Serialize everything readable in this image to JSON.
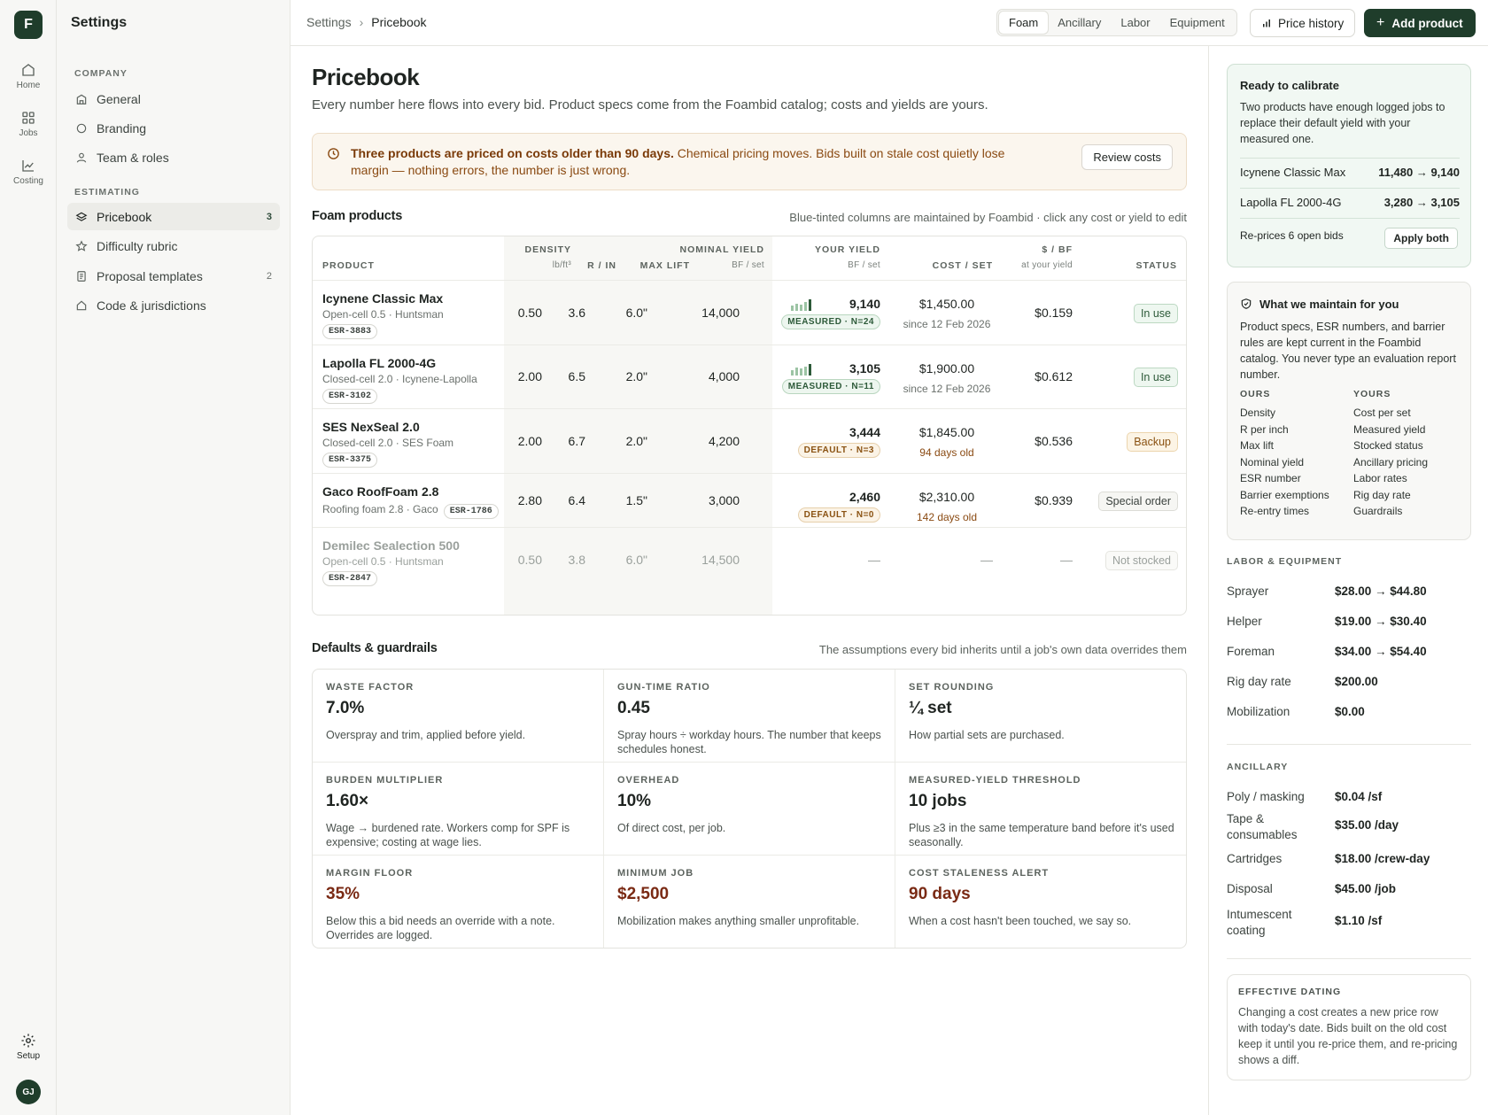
{
  "rail": {
    "logo": "F",
    "items": [
      {
        "label": "Home",
        "icon": "home-icon"
      },
      {
        "label": "Jobs",
        "icon": "grid-icon"
      },
      {
        "label": "Costing",
        "icon": "chart-line-icon"
      }
    ],
    "setup": "Setup",
    "avatar": "GJ"
  },
  "nav": {
    "title": "Settings",
    "sections": [
      {
        "heading": "COMPANY",
        "items": [
          {
            "label": "General",
            "count": ""
          },
          {
            "label": "Branding",
            "count": ""
          },
          {
            "label": "Team & roles",
            "count": ""
          }
        ]
      },
      {
        "heading": "ESTIMATING",
        "items": [
          {
            "label": "Pricebook",
            "count": "3"
          },
          {
            "label": "Difficulty rubric",
            "count": ""
          },
          {
            "label": "Proposal templates",
            "count": "2"
          },
          {
            "label": "Code & jurisdictions",
            "count": ""
          }
        ]
      }
    ]
  },
  "topbar": {
    "breadcrumb": [
      "Settings",
      "Pricebook"
    ],
    "tabs": [
      "Foam",
      "Ancillary",
      "Labor",
      "Equipment"
    ],
    "active_tab": "Foam",
    "price_history": "Price history",
    "add_product": "Add product"
  },
  "page": {
    "title": "Pricebook",
    "lede": "Every number here flows into every bid. Product specs come from the Foambid catalog; costs and yields are yours.",
    "alert_bold": "Three products are priced on costs older than 90 days.",
    "alert_text": " Chemical pricing moves. Bids built on stale cost quietly lose margin — nothing errors, the number is just wrong.",
    "review_costs": "Review costs"
  },
  "products": {
    "heading": "Foam products",
    "note": "Blue-tinted columns are maintained by Foambid · click any cost or yield to edit",
    "columns": {
      "product": "PRODUCT",
      "density": "DENSITY",
      "density_unit": "lb/ft³",
      "r_in": "R / IN",
      "max_lift": "MAX LIFT",
      "nominal": "NOMINAL YIELD",
      "nominal_unit": "BF / set",
      "your_yield": "YOUR YIELD",
      "your_yield_unit": "BF / set",
      "cost": "COST / SET",
      "per_bf": "$ / BF",
      "per_bf_unit": "at your yield",
      "status": "STATUS"
    },
    "rows": [
      {
        "name": "Icynene Classic Max",
        "meta": "Open-cell 0.5 · Huntsman",
        "esr": "ESR-3883",
        "density": "0.50",
        "r": "3.6",
        "lift": "6.0\"",
        "nominal": "14,000",
        "yield": "9,140",
        "yield_badge": "MEASURED · N=24",
        "yield_kind": "measured",
        "spark": [
          0.45,
          0.65,
          0.55,
          0.8,
          1
        ],
        "cost": "$1,450.00",
        "since": "since 12 Feb 2026",
        "since_kind": "ok",
        "per_bf": "$0.159",
        "status": "In use",
        "status_kind": "use"
      },
      {
        "name": "Lapolla FL 2000-4G",
        "meta": "Closed-cell 2.0 · Icynene-Lapolla",
        "esr": "ESR-3102",
        "density": "2.00",
        "r": "6.5",
        "lift": "2.0\"",
        "nominal": "4,000",
        "yield": "3,105",
        "yield_badge": "MEASURED · N=11",
        "yield_kind": "measured",
        "spark": [
          0.5,
          0.7,
          0.6,
          0.75,
          1
        ],
        "cost": "$1,900.00",
        "since": "since 12 Feb 2026",
        "since_kind": "ok",
        "per_bf": "$0.612",
        "status": "In use",
        "status_kind": "use"
      },
      {
        "name": "SES NexSeal 2.0",
        "meta": "Closed-cell 2.0 · SES Foam",
        "esr": "ESR-3375",
        "density": "2.00",
        "r": "6.7",
        "lift": "2.0\"",
        "nominal": "4,200",
        "yield": "3,444",
        "yield_badge": "DEFAULT · N=3",
        "yield_kind": "default",
        "spark": [],
        "cost": "$1,845.00",
        "since": "94 days old",
        "since_kind": "stale",
        "per_bf": "$0.536",
        "status": "Backup",
        "status_kind": "backup"
      },
      {
        "name": "Gaco RoofFoam 2.8",
        "meta": "Roofing foam 2.8 · Gaco",
        "esr": "ESR-1786",
        "density": "2.80",
        "r": "6.4",
        "lift": "1.5\"",
        "nominal": "3,000",
        "yield": "2,460",
        "yield_badge": "DEFAULT · N=0",
        "yield_kind": "default",
        "spark": [],
        "cost": "$2,310.00",
        "since": "142 days old",
        "since_kind": "stale",
        "per_bf": "$0.939",
        "status": "Special order",
        "status_kind": "special"
      },
      {
        "name": "Demilec Sealection 500",
        "meta": "Open-cell 0.5 · Huntsman",
        "esr": "ESR-2847",
        "density": "0.50",
        "r": "3.8",
        "lift": "6.0\"",
        "nominal": "14,500",
        "yield": "—",
        "yield_badge": "",
        "yield_kind": "none",
        "spark": [],
        "cost": "—",
        "since": "",
        "since_kind": "none",
        "per_bf": "—",
        "status": "Not stocked",
        "status_kind": "none"
      }
    ]
  },
  "defaults": {
    "heading": "Defaults & guardrails",
    "note": "The assumptions every bid inherits until a job's own data overrides them",
    "cells": [
      {
        "label": "WASTE FACTOR",
        "value": "7.0%",
        "desc": "Overspray and trim, applied before yield.",
        "warn": false
      },
      {
        "label": "GUN-TIME RATIO",
        "value": "0.45",
        "desc": "Spray hours ÷ workday hours. The number that keeps schedules honest.",
        "warn": false
      },
      {
        "label": "SET ROUNDING",
        "value": "¼ set",
        "desc": "How partial sets are purchased.",
        "warn": false
      },
      {
        "label": "BURDEN MULTIPLIER",
        "value": "1.60×",
        "desc": "Wage → burdened rate. Workers comp for SPF is expensive; costing at wage lies.",
        "warn": false
      },
      {
        "label": "OVERHEAD",
        "value": "10%",
        "desc": "Of direct cost, per job.",
        "warn": false
      },
      {
        "label": "MEASURED-YIELD THRESHOLD",
        "value": "10 jobs",
        "desc": "Plus ≥3 in the same temperature band before it's used seasonally.",
        "warn": false
      },
      {
        "label": "MARGIN FLOOR",
        "value": "35%",
        "desc": "Below this a bid needs an override with a note. Overrides are logged.",
        "warn": true
      },
      {
        "label": "MINIMUM JOB",
        "value": "$2,500",
        "desc": "Mobilization makes anything smaller unprofitable.",
        "warn": true
      },
      {
        "label": "COST STALENESS ALERT",
        "value": "90 days",
        "desc": "When a cost hasn't been touched, we say so.",
        "warn": true
      }
    ]
  },
  "side": {
    "calibrate": {
      "title": "Ready to calibrate",
      "text": "Two products have enough logged jobs to replace their default yield with your measured one.",
      "rows": [
        {
          "name": "Icynene Classic Max",
          "change": "11,480 → 9,140"
        },
        {
          "name": "Lapolla FL 2000-4G",
          "change": "3,280 → 3,105"
        }
      ],
      "reprice": "Re-prices 6 open bids",
      "apply": "Apply both"
    },
    "maintain": {
      "title": "What we maintain for you",
      "text": "Product specs, ESR numbers, and barrier rules are kept current in the Foambid catalog. You never type an evaluation report number.",
      "ours_h": "OURS",
      "yours_h": "YOURS",
      "ours": [
        "Density",
        "R per inch",
        "Max lift",
        "Nominal yield",
        "ESR number",
        "Barrier exemptions",
        "Re-entry times"
      ],
      "yours": [
        "Cost per set",
        "Measured yield",
        "Stocked status",
        "Ancillary pricing",
        "Labor rates",
        "Rig day rate",
        "Guardrails"
      ]
    },
    "labor": {
      "heading": "LABOR & EQUIPMENT",
      "rows": [
        {
          "label": "Sprayer",
          "value": "$28.00 → $44.80"
        },
        {
          "label": "Helper",
          "value": "$19.00 → $30.40"
        },
        {
          "label": "Foreman",
          "value": "$34.00 → $54.40"
        },
        {
          "label": "Rig day rate",
          "value": "$200.00"
        },
        {
          "label": "Mobilization",
          "value": "$0.00"
        }
      ]
    },
    "ancillary": {
      "heading": "ANCILLARY",
      "rows": [
        {
          "label": "Poly / masking",
          "value": "$0.04 /sf"
        },
        {
          "label": "Tape & consumables",
          "value": "$35.00 /day"
        },
        {
          "label": "Cartridges",
          "value": "$18.00 /crew-day"
        },
        {
          "label": "Disposal",
          "value": "$45.00 /job"
        },
        {
          "label": "Intumescent coating",
          "value": "$1.10 /sf"
        }
      ]
    },
    "dating": {
      "heading": "EFFECTIVE DATING",
      "text": "Changing a cost creates a new price row with today's date. Bids built on the old cost keep it until you re-price them, and re-pricing shows a diff."
    }
  }
}
